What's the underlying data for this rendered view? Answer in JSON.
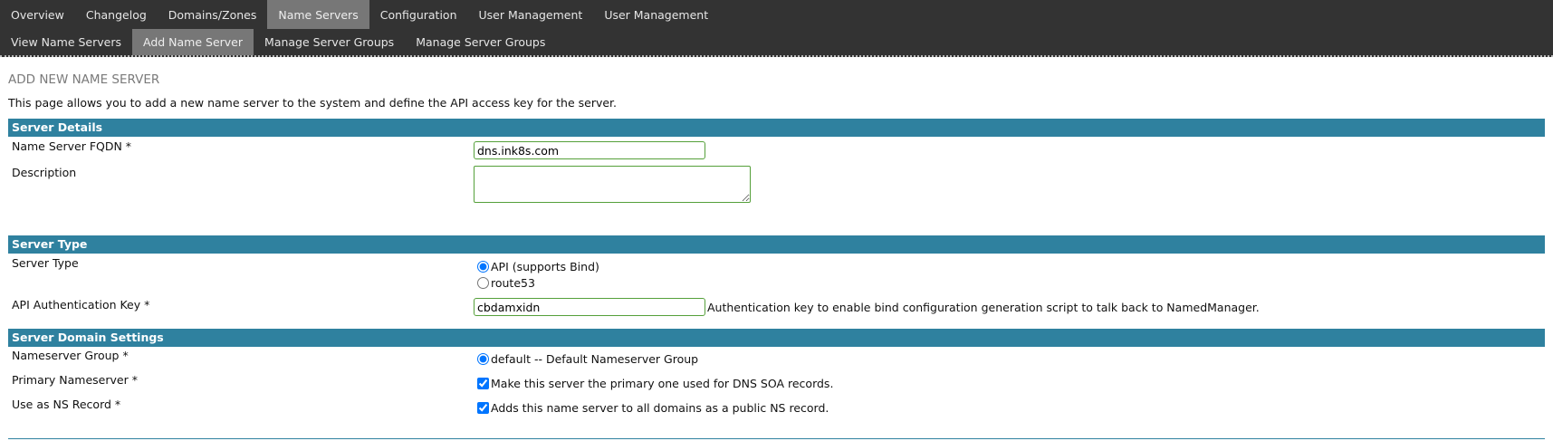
{
  "nav": {
    "primary": [
      "Overview",
      "Changelog",
      "Domains/Zones",
      "Name Servers",
      "Configuration",
      "User Management",
      "User Management"
    ],
    "primary_active": "Name Servers",
    "secondary": [
      "View Name Servers",
      "Add Name Server",
      "Manage Server Groups",
      "Manage Server Groups"
    ],
    "secondary_active": "Add Name Server"
  },
  "page": {
    "title": "ADD NEW NAME SERVER",
    "intro": "This page allows you to add a new name server to the system and define the API access key for the server."
  },
  "server_details": {
    "heading": "Server Details",
    "fqdn_label": "Name Server FQDN *",
    "fqdn_value": "dns.ink8s.com",
    "description_label": "Description",
    "description_value": ""
  },
  "server_type": {
    "heading": "Server Type",
    "type_label": "Server Type",
    "option_api": "API (supports Bind)",
    "option_route53": "route53",
    "selected": "API (supports Bind)",
    "api_key_label": "API Authentication Key *",
    "api_key_value": "cbdamxidn",
    "api_key_hint": "Authentication key to enable bind configuration generation script to talk back to NamedManager."
  },
  "domain_settings": {
    "heading": "Server Domain Settings",
    "group_label": "Nameserver Group *",
    "group_option": "default -- Default Nameserver Group",
    "primary_label": "Primary Nameserver *",
    "primary_text": "Make this server the primary one used for DNS SOA records.",
    "primary_checked": true,
    "ns_label": "Use as NS Record *",
    "ns_text": "Adds this name server to all domains as a public NS record.",
    "ns_checked": true
  },
  "colors": {
    "nav_bg": "#333333",
    "nav_active": "#777777",
    "section_bg": "#2f819f",
    "input_border": "#55a03a"
  }
}
